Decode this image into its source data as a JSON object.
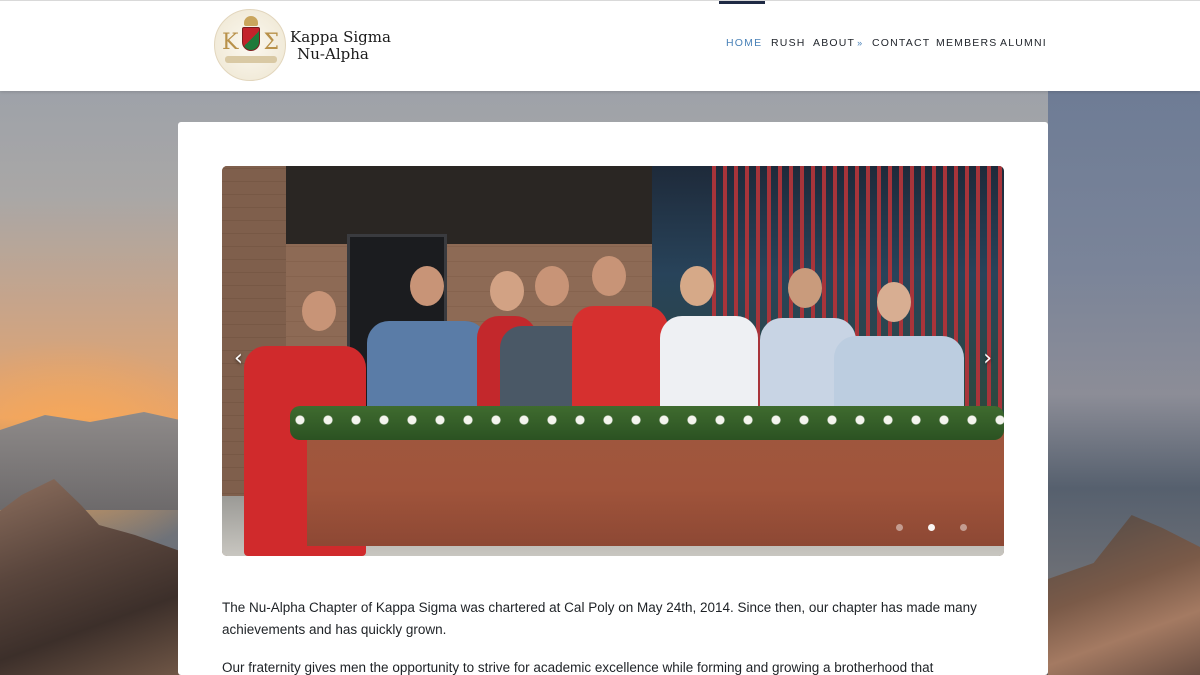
{
  "brand": {
    "name_line1": "Kappa Sigma",
    "name_line2": "Nu-Alpha",
    "logo_letters": [
      "Κ",
      "Σ"
    ]
  },
  "nav": {
    "items": [
      {
        "label": "HOME",
        "active": true
      },
      {
        "label": "RUSH"
      },
      {
        "label": "ABOUT",
        "has_dropdown": true,
        "icon": "chevron-down-double-icon"
      },
      {
        "label": "CONTACT"
      },
      {
        "label": "MEMBERS"
      },
      {
        "label": "ALUMNI"
      }
    ],
    "dropdown_glyph": "»",
    "active_color": "#4a82b8",
    "indicator_color": "#1f2a44"
  },
  "slider": {
    "prev_glyph": "‹",
    "next_glyph": "›",
    "slide_count": 3,
    "active_index": 1
  },
  "content": {
    "paragraph1": "The Nu-Alpha Chapter of Kappa Sigma was chartered at Cal Poly on May 24th, 2014. Since then, our chapter has made many achievements and has quickly grown.",
    "paragraph2": "Our fraternity gives men the opportunity to strive for academic excellence while forming and growing a brotherhood that exemplifies"
  }
}
